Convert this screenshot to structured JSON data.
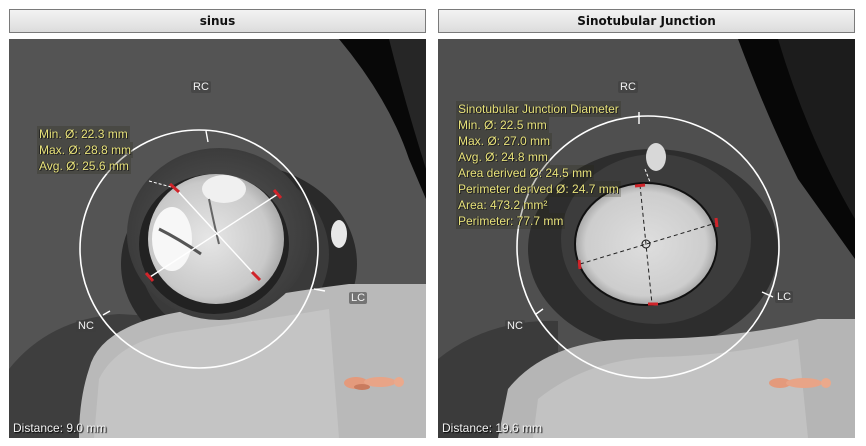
{
  "panels": [
    {
      "title": "sinus",
      "distance": "Distance: 9.0 mm",
      "labels": {
        "rc": "RC",
        "lc": "LC",
        "nc": "NC"
      },
      "measurements": [
        "Min. Ø: 22.3 mm",
        "Max. Ø: 28.8 mm",
        "Avg. Ø: 25.6 mm"
      ]
    },
    {
      "title": "Sinotubular Junction",
      "distance": "Distance: 19.6 mm",
      "labels": {
        "rc": "RC",
        "lc": "LC",
        "nc": "NC"
      },
      "measurements": [
        "Sinotubular Junction Diameter",
        "Min. Ø: 22.5 mm",
        "Max. Ø: 27.0 mm",
        "Avg. Ø: 24.8 mm",
        "Area derived Ø: 24.5 mm",
        "Perimeter derived Ø: 24.7 mm",
        "Area: 473.2 mm²",
        "Perimeter: 77.7 mm"
      ]
    }
  ],
  "colors": {
    "measurement_text": "#e8e27a",
    "marker": "#d0242a",
    "ring": "#ffffff"
  },
  "icons": {
    "orientation": "body-orientation-icon"
  }
}
